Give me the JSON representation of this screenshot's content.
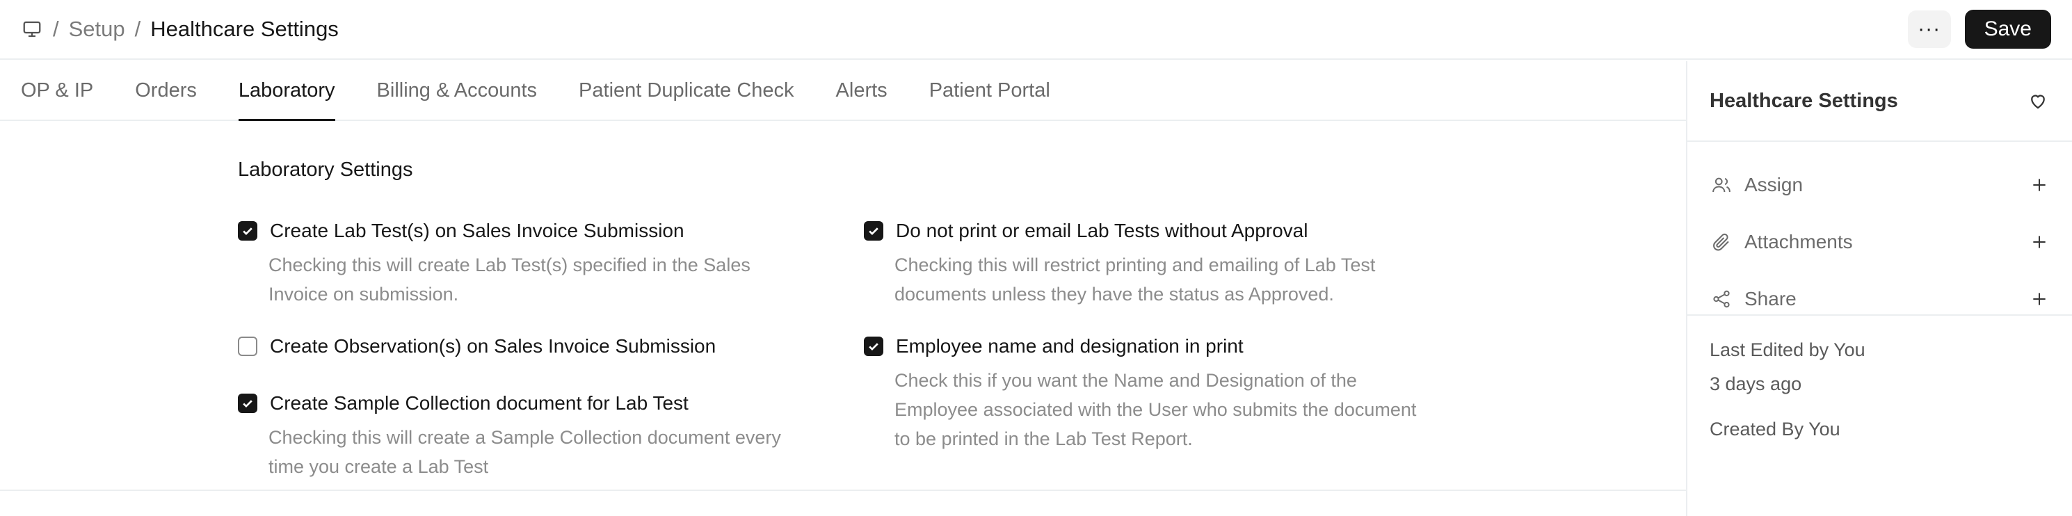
{
  "header": {
    "breadcrumb_root": "Setup",
    "title": "Healthcare Settings",
    "more_label": "···",
    "save_label": "Save"
  },
  "tabs": [
    {
      "label": "OP & IP"
    },
    {
      "label": "Orders"
    },
    {
      "label": "Laboratory"
    },
    {
      "label": "Billing & Accounts"
    },
    {
      "label": "Patient Duplicate Check"
    },
    {
      "label": "Alerts"
    },
    {
      "label": "Patient Portal"
    }
  ],
  "active_tab": "Laboratory",
  "section": {
    "title": "Laboratory Settings",
    "fields": [
      {
        "label": "Create Lab Test(s) on Sales Invoice Submission",
        "checked": true,
        "desc_line1": "Checking this will create Lab Test(s) specified in the Sales",
        "desc_line2": "Invoice on submission."
      },
      {
        "label": "Create Observation(s) on Sales Invoice Submission",
        "checked": false
      },
      {
        "label": "Create Sample Collection document for Lab Test",
        "checked": true,
        "desc_line1": "Checking this will create a Sample Collection document every",
        "desc_line2": "time you create a Lab Test"
      },
      {
        "label": "Do not print or email Lab Tests without Approval",
        "checked": true,
        "desc_line1": "Checking this will restrict printing and emailing of Lab Test",
        "desc_line2": "documents unless they have the status as Approved."
      },
      {
        "label": "Employee name and designation in print",
        "checked": true,
        "desc_line1": "Check this if you want the Name and Designation of the",
        "desc_line2": "Employee associated with the User who submits the document",
        "desc_line3": "to be printed in the Lab Test Report."
      }
    ]
  },
  "sidebar": {
    "title": "Healthcare Settings",
    "items": [
      {
        "label": "Assign",
        "icon": "users-icon"
      },
      {
        "label": "Attachments",
        "icon": "paperclip-icon"
      },
      {
        "label": "Share",
        "icon": "share-icon"
      }
    ],
    "last_edited": "Last Edited by You",
    "last_edited_time": "3 days ago",
    "created_by": "Created By You"
  },
  "colors": {
    "primary": "#171717",
    "muted": "#8c8c8c",
    "border": "#ebeef0"
  }
}
